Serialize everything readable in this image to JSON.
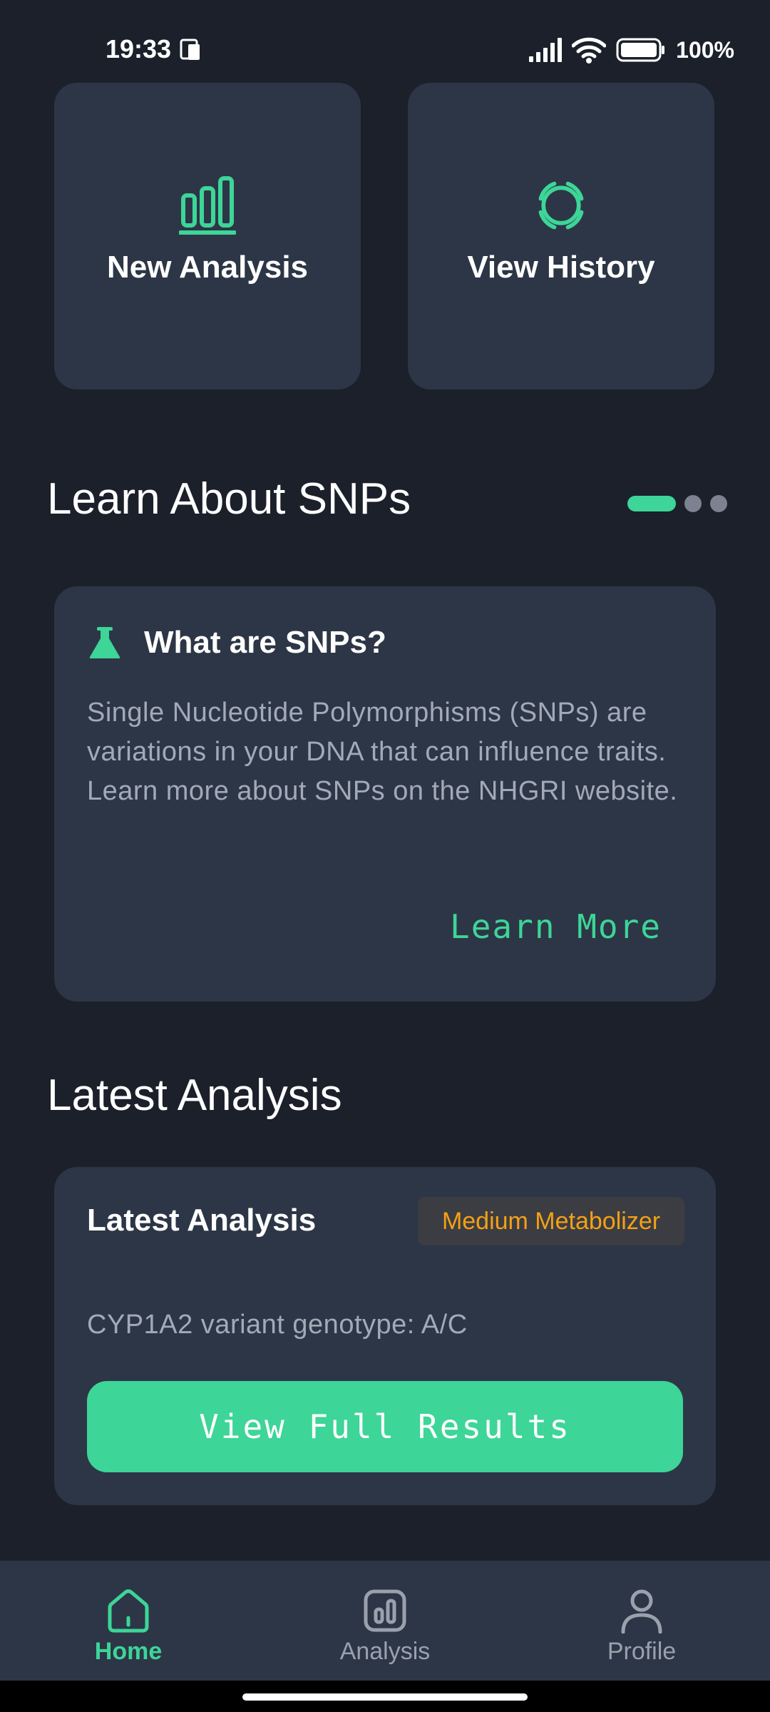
{
  "status_bar": {
    "time": "19:33",
    "battery": "100%"
  },
  "actions": {
    "new_analysis": {
      "label": "New Analysis",
      "icon": "bar-chart-icon"
    },
    "view_history": {
      "label": "View History",
      "icon": "history-ring-icon"
    }
  },
  "learn": {
    "section_title": "Learn About SNPs",
    "pager": {
      "total": 3,
      "active_index": 0
    },
    "card": {
      "icon": "flask-icon",
      "title": "What are SNPs?",
      "body": "Single Nucleotide Polymorphisms (SNPs) are variations in your DNA that can influence traits. Learn more about SNPs on the NHGRI website.",
      "link_label": "Learn More"
    }
  },
  "latest": {
    "section_title": "Latest Analysis",
    "card": {
      "title": "Latest Analysis",
      "badge": "Medium Metabolizer",
      "genotype": "CYP1A2 variant genotype: A/C",
      "button_label": "View Full Results"
    }
  },
  "nav": {
    "items": [
      {
        "label": "Home",
        "icon": "home-icon",
        "active": true
      },
      {
        "label": "Analysis",
        "icon": "analysis-icon",
        "active": false
      },
      {
        "label": "Profile",
        "icon": "profile-icon",
        "active": false
      }
    ]
  },
  "colors": {
    "background": "#1b202b",
    "card": "#2d3646",
    "accent": "#3dd598",
    "badge_text": "#f4a016",
    "muted_text": "#a2aab7"
  }
}
